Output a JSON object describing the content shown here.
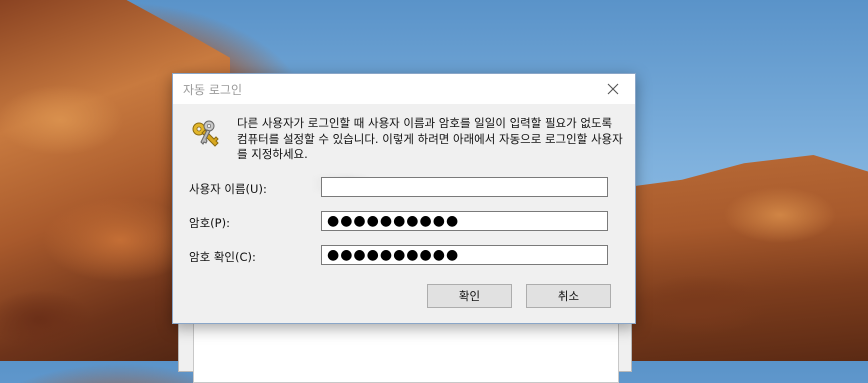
{
  "dialog": {
    "title": "자동 로그인",
    "description": "다른 사용자가 로그인할 때 사용자 이름과 암호를 일일이 입력할 필요가 없도록 컴퓨터를 설정할 수 있습니다. 이렇게 하려면 아래에서 자동으로 로그인할 사용자를 지정하세요.",
    "username_label": "사용자 이름(U):",
    "username_value": "",
    "password_label": "암호(P):",
    "password_value": "●●●●●●●●●●",
    "confirm_label": "암호 확인(C):",
    "confirm_value": "●●●●●●●●●●",
    "ok_label": "확인",
    "cancel_label": "취소"
  },
  "icons": {
    "close": "close-icon",
    "keys": "keys-icon"
  },
  "colors": {
    "dialog_bg": "#f0f0f0",
    "title_text": "#9a9a9a",
    "button_bg": "#e1e1e1"
  }
}
